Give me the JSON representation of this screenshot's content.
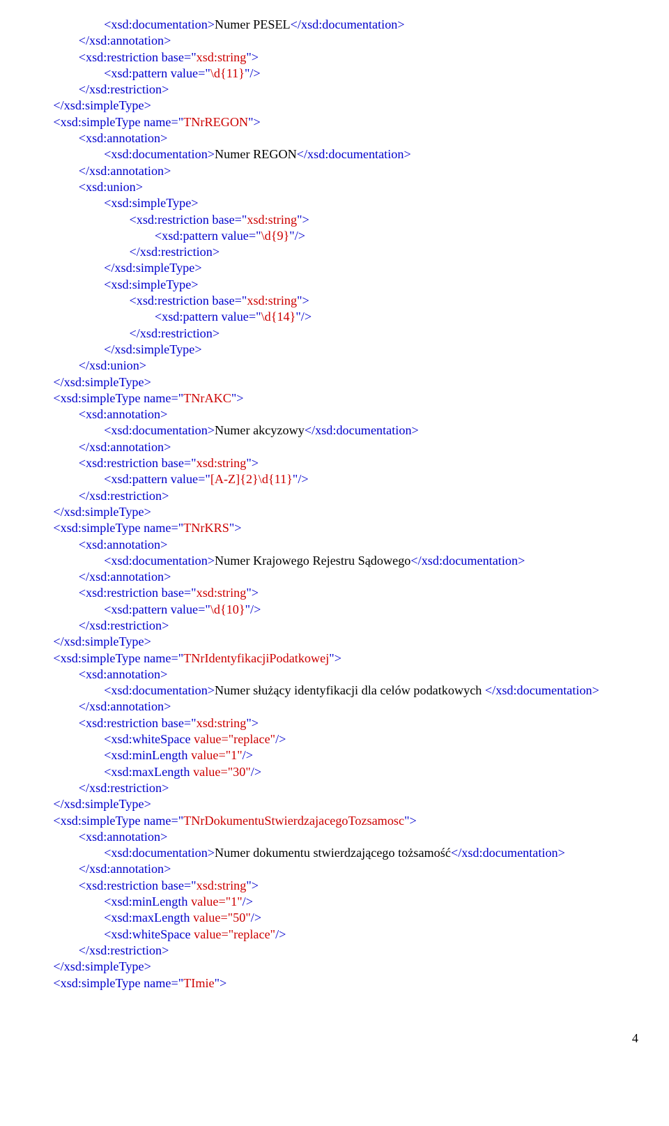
{
  "page_number": "4",
  "lines": [
    {
      "indent": 3,
      "segs": [
        {
          "c": "blue",
          "t": "<xsd:documentation>"
        },
        {
          "c": "black",
          "t": "Numer PESEL"
        },
        {
          "c": "blue",
          "t": "</xsd:documentation>"
        }
      ]
    },
    {
      "indent": 2,
      "segs": [
        {
          "c": "blue",
          "t": "</xsd:annotation>"
        }
      ]
    },
    {
      "indent": 2,
      "segs": [
        {
          "c": "blue",
          "t": "<xsd:restriction base"
        },
        {
          "c": "blue",
          "t": "=\""
        },
        {
          "c": "red",
          "t": "xsd:string"
        },
        {
          "c": "blue",
          "t": "\">"
        }
      ]
    },
    {
      "indent": 3,
      "segs": [
        {
          "c": "blue",
          "t": "<xsd:pattern value=\""
        },
        {
          "c": "red",
          "t": "\\d{11}"
        },
        {
          "c": "blue",
          "t": "\"/>"
        }
      ]
    },
    {
      "indent": 2,
      "segs": [
        {
          "c": "blue",
          "t": "</xsd:restriction>"
        }
      ]
    },
    {
      "indent": 1,
      "segs": [
        {
          "c": "blue",
          "t": "</xsd:simpleType>"
        }
      ]
    },
    {
      "indent": 1,
      "segs": [
        {
          "c": "blue",
          "t": "<xsd:simpleType name=\""
        },
        {
          "c": "red",
          "t": "TNrREGON"
        },
        {
          "c": "blue",
          "t": "\">"
        }
      ]
    },
    {
      "indent": 2,
      "segs": [
        {
          "c": "blue",
          "t": "<xsd:annotation>"
        }
      ]
    },
    {
      "indent": 3,
      "segs": [
        {
          "c": "blue",
          "t": "<xsd:documentation>"
        },
        {
          "c": "black",
          "t": "Numer REGON"
        },
        {
          "c": "blue",
          "t": "</xsd:documentation>"
        }
      ]
    },
    {
      "indent": 2,
      "segs": [
        {
          "c": "blue",
          "t": "</xsd:annotation>"
        }
      ]
    },
    {
      "indent": 2,
      "segs": [
        {
          "c": "blue",
          "t": "<xsd:union>"
        }
      ]
    },
    {
      "indent": 3,
      "segs": [
        {
          "c": "blue",
          "t": "<xsd:simpleType>"
        }
      ]
    },
    {
      "indent": 4,
      "segs": [
        {
          "c": "blue",
          "t": "<xsd:restriction base=\""
        },
        {
          "c": "red",
          "t": "xsd:string"
        },
        {
          "c": "blue",
          "t": "\">"
        }
      ]
    },
    {
      "indent": 5,
      "segs": [
        {
          "c": "blue",
          "t": "<xsd:pattern value=\""
        },
        {
          "c": "red",
          "t": "\\d{9}"
        },
        {
          "c": "blue",
          "t": "\"/>"
        }
      ]
    },
    {
      "indent": 4,
      "segs": [
        {
          "c": "blue",
          "t": "</xsd:restriction>"
        }
      ]
    },
    {
      "indent": 3,
      "segs": [
        {
          "c": "blue",
          "t": "</xsd:simpleType>"
        }
      ]
    },
    {
      "indent": 3,
      "segs": [
        {
          "c": "blue",
          "t": "<xsd:simpleType>"
        }
      ]
    },
    {
      "indent": 4,
      "segs": [
        {
          "c": "blue",
          "t": "<xsd:restriction base=\""
        },
        {
          "c": "red",
          "t": "xsd:string"
        },
        {
          "c": "blue",
          "t": "\">"
        }
      ]
    },
    {
      "indent": 5,
      "segs": [
        {
          "c": "blue",
          "t": "<xsd:pattern value=\""
        },
        {
          "c": "red",
          "t": "\\d{14}"
        },
        {
          "c": "blue",
          "t": "\"/>"
        }
      ]
    },
    {
      "indent": 4,
      "segs": [
        {
          "c": "blue",
          "t": "</xsd:restriction>"
        }
      ]
    },
    {
      "indent": 3,
      "segs": [
        {
          "c": "blue",
          "t": "</xsd:simpleType>"
        }
      ]
    },
    {
      "indent": 2,
      "segs": [
        {
          "c": "blue",
          "t": "</xsd:union>"
        }
      ]
    },
    {
      "indent": 1,
      "segs": [
        {
          "c": "blue",
          "t": "</xsd:simpleType>"
        }
      ]
    },
    {
      "indent": 1,
      "segs": [
        {
          "c": "blue",
          "t": "<xsd:simpleType name=\""
        },
        {
          "c": "red",
          "t": "TNrAKC"
        },
        {
          "c": "blue",
          "t": "\">"
        }
      ]
    },
    {
      "indent": 2,
      "segs": [
        {
          "c": "blue",
          "t": "<xsd:annotation>"
        }
      ]
    },
    {
      "indent": 3,
      "segs": [
        {
          "c": "blue",
          "t": "<xsd:documentation>"
        },
        {
          "c": "black",
          "t": "Numer akcyzowy"
        },
        {
          "c": "blue",
          "t": "</xsd:documentation>"
        }
      ]
    },
    {
      "indent": 2,
      "segs": [
        {
          "c": "blue",
          "t": "</xsd:annotation>"
        }
      ]
    },
    {
      "indent": 2,
      "segs": [
        {
          "c": "blue",
          "t": "<xsd:restriction base=\""
        },
        {
          "c": "red",
          "t": "xsd:string"
        },
        {
          "c": "blue",
          "t": "\">"
        }
      ]
    },
    {
      "indent": 3,
      "segs": [
        {
          "c": "blue",
          "t": "<xsd:pattern value=\""
        },
        {
          "c": "red",
          "t": "[A-Z]{2}\\d{11}"
        },
        {
          "c": "blue",
          "t": "\"/>"
        }
      ]
    },
    {
      "indent": 2,
      "segs": [
        {
          "c": "blue",
          "t": "</xsd:restriction>"
        }
      ]
    },
    {
      "indent": 1,
      "segs": [
        {
          "c": "blue",
          "t": "</xsd:simpleType>"
        }
      ]
    },
    {
      "indent": 1,
      "segs": [
        {
          "c": "blue",
          "t": "<xsd:simpleType name=\""
        },
        {
          "c": "red",
          "t": "TNrKRS"
        },
        {
          "c": "blue",
          "t": "\">"
        }
      ]
    },
    {
      "indent": 2,
      "segs": [
        {
          "c": "blue",
          "t": "<xsd:annotation>"
        }
      ]
    },
    {
      "indent": 3,
      "segs": [
        {
          "c": "blue",
          "t": "<xsd:documentation>"
        },
        {
          "c": "black",
          "t": "Numer Krajowego Rejestru Sądowego"
        },
        {
          "c": "blue",
          "t": "</xsd:documentation>"
        }
      ]
    },
    {
      "indent": 2,
      "segs": [
        {
          "c": "blue",
          "t": "</xsd:annotation>"
        }
      ]
    },
    {
      "indent": 2,
      "segs": [
        {
          "c": "blue",
          "t": "<xsd:restriction base=\""
        },
        {
          "c": "red",
          "t": "xsd:string"
        },
        {
          "c": "blue",
          "t": "\">"
        }
      ]
    },
    {
      "indent": 3,
      "segs": [
        {
          "c": "blue",
          "t": "<xsd:pattern value=\""
        },
        {
          "c": "red",
          "t": "\\d{10}"
        },
        {
          "c": "blue",
          "t": "\"/>"
        }
      ]
    },
    {
      "indent": 2,
      "segs": [
        {
          "c": "blue",
          "t": "</xsd:restriction>"
        }
      ]
    },
    {
      "indent": 1,
      "segs": [
        {
          "c": "blue",
          "t": "</xsd:simpleType>"
        }
      ]
    },
    {
      "indent": 1,
      "segs": [
        {
          "c": "blue",
          "t": "<xsd:simpleType name=\""
        },
        {
          "c": "red",
          "t": "TNrIdentyfikacjiPodatkowej"
        },
        {
          "c": "blue",
          "t": "\">"
        }
      ]
    },
    {
      "indent": 2,
      "segs": [
        {
          "c": "blue",
          "t": "<xsd:annotation>"
        }
      ]
    },
    {
      "indent": 3,
      "segs": [
        {
          "c": "blue",
          "t": "<xsd:documentation>"
        },
        {
          "c": "black",
          "t": "Numer służący identyfikacji dla celów podatkowych "
        },
        {
          "c": "blue",
          "t": "</xsd:documentation>"
        }
      ]
    },
    {
      "indent": 2,
      "segs": [
        {
          "c": "blue",
          "t": "</xsd:annotation>"
        }
      ]
    },
    {
      "indent": 2,
      "segs": [
        {
          "c": "blue",
          "t": "<xsd:restriction base=\""
        },
        {
          "c": "red",
          "t": "xsd:string"
        },
        {
          "c": "blue",
          "t": "\">"
        }
      ]
    },
    {
      "indent": 3,
      "segs": [
        {
          "c": "blue",
          "t": "<xsd:whiteSpace "
        },
        {
          "c": "red",
          "t": "value=\"replace\""
        },
        {
          "c": "blue",
          "t": "/>"
        }
      ]
    },
    {
      "indent": 3,
      "segs": [
        {
          "c": "blue",
          "t": "<xsd:minLength "
        },
        {
          "c": "red",
          "t": "value=\"1\""
        },
        {
          "c": "blue",
          "t": "/>"
        }
      ]
    },
    {
      "indent": 3,
      "segs": [
        {
          "c": "blue",
          "t": "<xsd:maxLength "
        },
        {
          "c": "red",
          "t": "value=\"30\""
        },
        {
          "c": "blue",
          "t": "/>"
        }
      ]
    },
    {
      "indent": 2,
      "segs": [
        {
          "c": "blue",
          "t": "</xsd:restriction>"
        }
      ]
    },
    {
      "indent": 1,
      "segs": [
        {
          "c": "blue",
          "t": "</xsd:simpleType>"
        }
      ]
    },
    {
      "indent": 1,
      "segs": [
        {
          "c": "blue",
          "t": "<xsd:simpleType name=\""
        },
        {
          "c": "red",
          "t": "TNrDokumentuStwierdzajacegoTozsamosc"
        },
        {
          "c": "blue",
          "t": "\">"
        }
      ]
    },
    {
      "indent": 2,
      "segs": [
        {
          "c": "blue",
          "t": "<xsd:annotation>"
        }
      ]
    },
    {
      "indent": 3,
      "segs": [
        {
          "c": "blue",
          "t": "<xsd:documentation>"
        },
        {
          "c": "black",
          "t": "Numer dokumentu stwierdzającego tożsamość"
        },
        {
          "c": "blue",
          "t": "</xsd:documentation>"
        }
      ]
    },
    {
      "indent": 2,
      "segs": [
        {
          "c": "blue",
          "t": "</xsd:annotation>"
        }
      ]
    },
    {
      "indent": 2,
      "segs": [
        {
          "c": "blue",
          "t": "<xsd:restriction base=\""
        },
        {
          "c": "red",
          "t": "xsd:string"
        },
        {
          "c": "blue",
          "t": "\">"
        }
      ]
    },
    {
      "indent": 3,
      "segs": [
        {
          "c": "blue",
          "t": "<xsd:minLength "
        },
        {
          "c": "red",
          "t": "value=\"1\""
        },
        {
          "c": "blue",
          "t": "/>"
        }
      ]
    },
    {
      "indent": 3,
      "segs": [
        {
          "c": "blue",
          "t": "<xsd:maxLength "
        },
        {
          "c": "red",
          "t": "value=\"50\""
        },
        {
          "c": "blue",
          "t": "/>"
        }
      ]
    },
    {
      "indent": 3,
      "segs": [
        {
          "c": "blue",
          "t": "<xsd:whiteSpace "
        },
        {
          "c": "red",
          "t": "value=\"replace\""
        },
        {
          "c": "blue",
          "t": "/>"
        }
      ]
    },
    {
      "indent": 2,
      "segs": [
        {
          "c": "blue",
          "t": "</xsd:restriction>"
        }
      ]
    },
    {
      "indent": 1,
      "segs": [
        {
          "c": "blue",
          "t": "</xsd:simpleType>"
        }
      ]
    },
    {
      "indent": 1,
      "segs": [
        {
          "c": "blue",
          "t": "<xsd:simpleType name=\""
        },
        {
          "c": "red",
          "t": "TImie"
        },
        {
          "c": "blue",
          "t": "\">"
        }
      ]
    }
  ]
}
